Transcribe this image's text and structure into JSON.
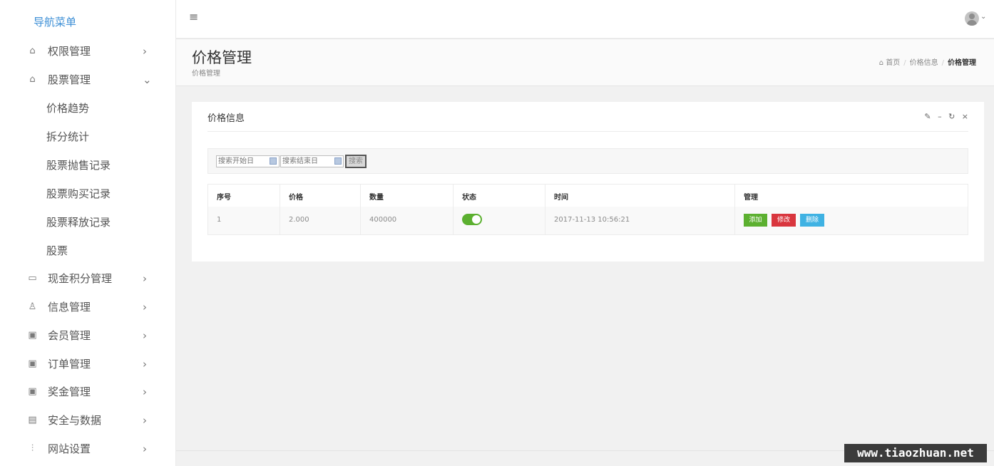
{
  "sidebar": {
    "title": "导航菜单",
    "items": [
      {
        "label": "权限管理",
        "icon": "mortarboard-icon",
        "glyph": "⌂",
        "chevron": "›"
      },
      {
        "label": "股票管理",
        "icon": "mortarboard-icon",
        "glyph": "⌂",
        "chevron": "⌄"
      },
      {
        "label": "现金积分管理",
        "icon": "tag-icon",
        "glyph": "▭",
        "chevron": "›"
      },
      {
        "label": "信息管理",
        "icon": "shirt-icon",
        "glyph": "♙",
        "chevron": "›"
      },
      {
        "label": "会员管理",
        "icon": "monitor-icon",
        "glyph": "▣",
        "chevron": "›"
      },
      {
        "label": "订单管理",
        "icon": "monitor-icon",
        "glyph": "▣",
        "chevron": "›"
      },
      {
        "label": "奖金管理",
        "icon": "monitor-icon",
        "glyph": "▣",
        "chevron": "›"
      },
      {
        "label": "安全与数据",
        "icon": "wallet-icon",
        "glyph": "▤",
        "chevron": "›"
      },
      {
        "label": "网站设置",
        "icon": "sliders-icon",
        "glyph": "⫶",
        "chevron": "›"
      }
    ],
    "subitems": [
      "价格趋势",
      "拆分统计",
      "股票抛售记录",
      "股票购买记录",
      "股票释放记录",
      "股票"
    ]
  },
  "topbar": {
    "menu_icon": "≡",
    "avatar_caret": "⌄"
  },
  "page": {
    "title": "价格管理",
    "subtitle": "价格管理",
    "breadcrumb": {
      "home": "首页",
      "middle": "价格信息",
      "current": "价格管理",
      "sep": "/"
    }
  },
  "panel": {
    "title": "价格信息",
    "tools": {
      "wrench": "✎",
      "minimize": "–",
      "refresh": "↻",
      "close": "×"
    },
    "search": {
      "start_placeholder": "搜索开始日",
      "end_placeholder": "搜索结束日",
      "button": "搜索"
    },
    "table": {
      "headers": [
        "序号",
        "价格",
        "数量",
        "状态",
        "时间",
        "管理"
      ],
      "rows": [
        {
          "id": "1",
          "price": "2.000",
          "quantity": "400000",
          "status_on": true,
          "time": "2017-11-13 10:56:21"
        }
      ],
      "actions": {
        "add": "添加",
        "edit": "修改",
        "delete": "删除"
      }
    }
  },
  "watermark": "www.tiaozhuan.net",
  "colors": {
    "accent": "#3d8fd6",
    "add": "#5cb030",
    "edit": "#d9363e",
    "delete": "#3fb2e3"
  }
}
